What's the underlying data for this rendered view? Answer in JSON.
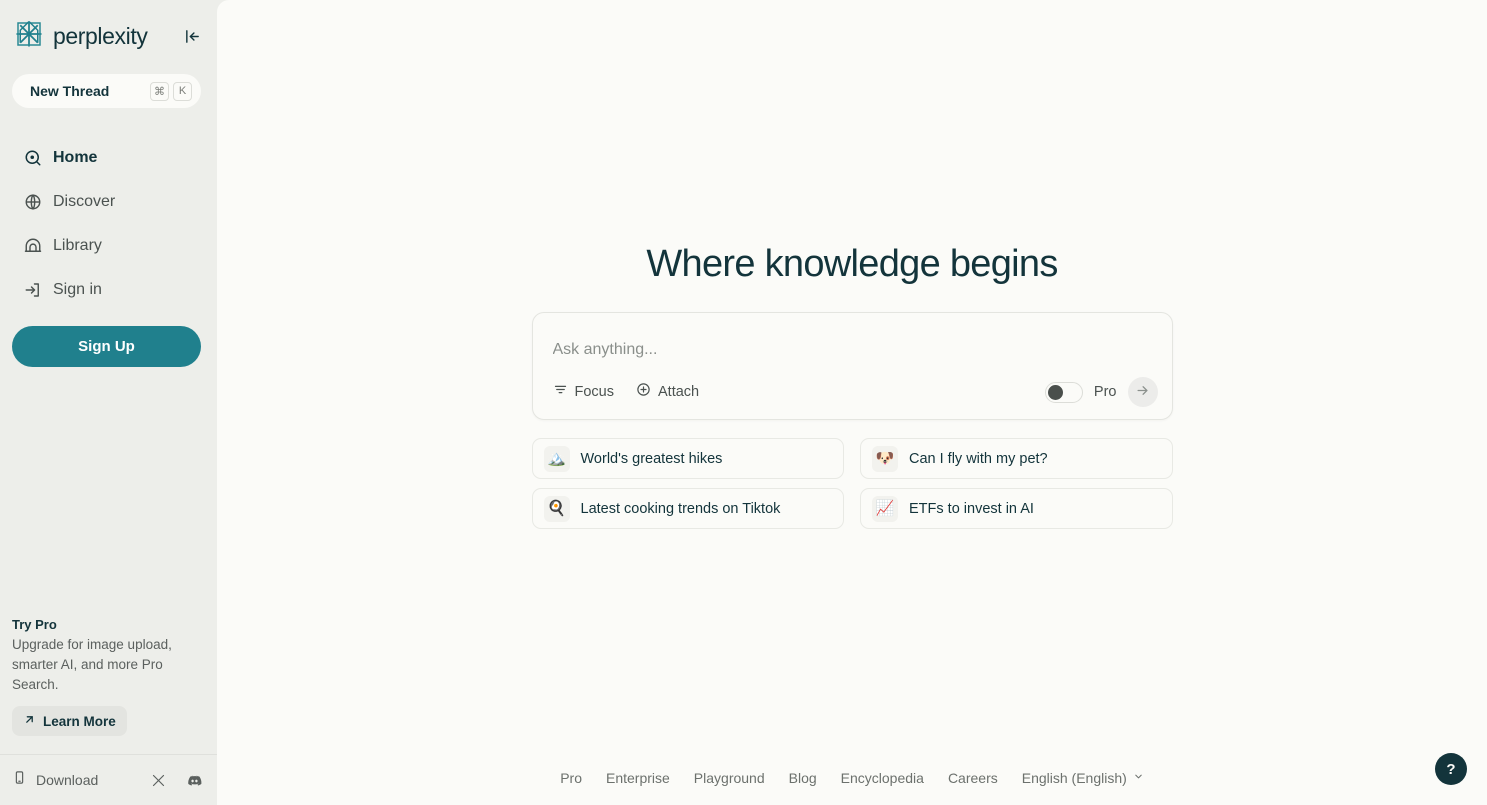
{
  "brand": {
    "name": "perplexity",
    "logo_icon": "perplexity-logo",
    "collapse_icon": "collapse-sidebar-icon"
  },
  "sidebar": {
    "new_thread": {
      "label": "New Thread",
      "keys": [
        "⌘",
        "K"
      ]
    },
    "nav": [
      {
        "label": "Home",
        "icon": "home-target-icon",
        "active": true
      },
      {
        "label": "Discover",
        "icon": "globe-icon",
        "active": false
      },
      {
        "label": "Library",
        "icon": "library-icon",
        "active": false
      },
      {
        "label": "Sign in",
        "icon": "sign-in-icon",
        "active": false
      }
    ],
    "signup_label": "Sign Up",
    "try_pro": {
      "title": "Try Pro",
      "description": "Upgrade for image upload, smarter AI, and more Pro Search.",
      "learn_more_label": "Learn More",
      "learn_more_icon": "arrow-up-right-icon"
    },
    "bottom": {
      "download_label": "Download",
      "download_icon": "phone-icon",
      "socials": [
        {
          "name": "x-twitter-icon"
        },
        {
          "name": "discord-icon"
        }
      ]
    }
  },
  "main": {
    "headline": "Where knowledge begins",
    "ask": {
      "placeholder": "Ask anything...",
      "value": "",
      "focus_label": "Focus",
      "focus_icon": "focus-filter-icon",
      "attach_label": "Attach",
      "attach_icon": "plus-circle-icon",
      "pro_label": "Pro",
      "pro_enabled": false,
      "submit_icon": "arrow-right-icon"
    },
    "suggestions": [
      {
        "emoji": "🏔️",
        "icon": "mountain-emoji",
        "label": "World's greatest hikes"
      },
      {
        "emoji": "🐶",
        "icon": "dog-face-emoji",
        "label": "Can I fly with my pet?"
      },
      {
        "emoji": "🍳",
        "icon": "cooking-pan-emoji",
        "label": "Latest cooking trends on Tiktok"
      },
      {
        "emoji": "📈",
        "icon": "chart-increasing-emoji",
        "label": "ETFs to invest in AI"
      }
    ],
    "footer": {
      "links": [
        "Pro",
        "Enterprise",
        "Playground",
        "Blog",
        "Encyclopedia",
        "Careers"
      ],
      "language": "English (English)",
      "language_chevron": "chevron-down-icon"
    },
    "help_label": "?"
  },
  "colors": {
    "accent_teal": "#20808d",
    "dark_slate": "#13343b",
    "sidebar_bg": "#edeeea",
    "main_bg": "#fbfbf8"
  }
}
